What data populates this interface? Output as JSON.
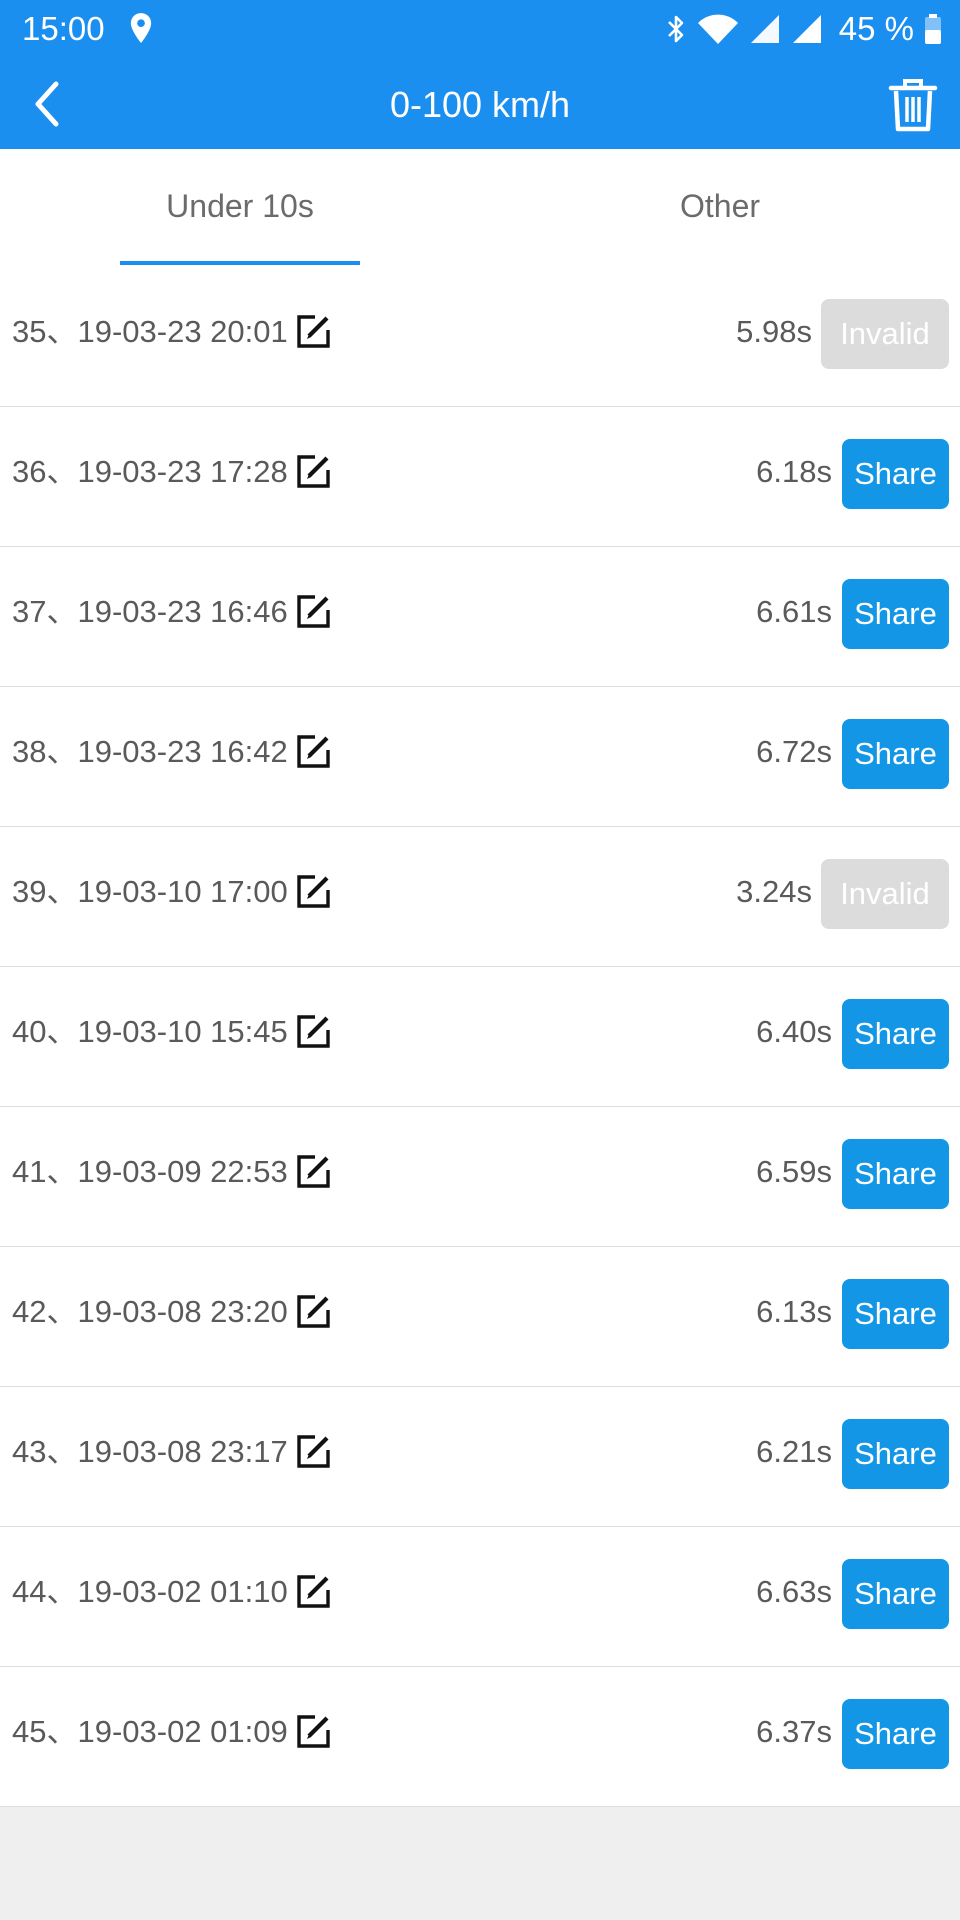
{
  "status_bar": {
    "time": "15:00",
    "battery": "45 %"
  },
  "header": {
    "title": "0-100 km/h",
    "bg_color": "#1b8ff0"
  },
  "tabs": [
    {
      "label": "Under 10s",
      "active": true
    },
    {
      "label": "Other",
      "active": false
    }
  ],
  "rows": [
    {
      "label": "35、19-03-23 20:01",
      "time": "5.98s",
      "button": "Invalid",
      "valid": false
    },
    {
      "label": "36、19-03-23 17:28",
      "time": "6.18s",
      "button": "Share",
      "valid": true
    },
    {
      "label": "37、19-03-23 16:46",
      "time": "6.61s",
      "button": "Share",
      "valid": true
    },
    {
      "label": "38、19-03-23 16:42",
      "time": "6.72s",
      "button": "Share",
      "valid": true
    },
    {
      "label": "39、19-03-10 17:00",
      "time": "3.24s",
      "button": "Invalid",
      "valid": false
    },
    {
      "label": "40、19-03-10 15:45",
      "time": "6.40s",
      "button": "Share",
      "valid": true
    },
    {
      "label": "41、19-03-09 22:53",
      "time": "6.59s",
      "button": "Share",
      "valid": true
    },
    {
      "label": "42、19-03-08 23:20",
      "time": "6.13s",
      "button": "Share",
      "valid": true
    },
    {
      "label": "43、19-03-08 23:17",
      "time": "6.21s",
      "button": "Share",
      "valid": true
    },
    {
      "label": "44、19-03-02 01:10",
      "time": "6.63s",
      "button": "Share",
      "valid": true
    },
    {
      "label": "45、19-03-02 01:09",
      "time": "6.37s",
      "button": "Share",
      "valid": true
    }
  ],
  "icons": {
    "status": [
      "location-icon",
      "bluetooth-icon",
      "wifi-icon",
      "signal-icon",
      "battery-icon"
    ],
    "header": [
      "back-icon",
      "trash-icon"
    ],
    "row": "edit-icon"
  },
  "colors": {
    "share_button": "#1496e6",
    "invalid_button": "#dcdcdc",
    "tab_indicator": "#1b8ff0"
  }
}
